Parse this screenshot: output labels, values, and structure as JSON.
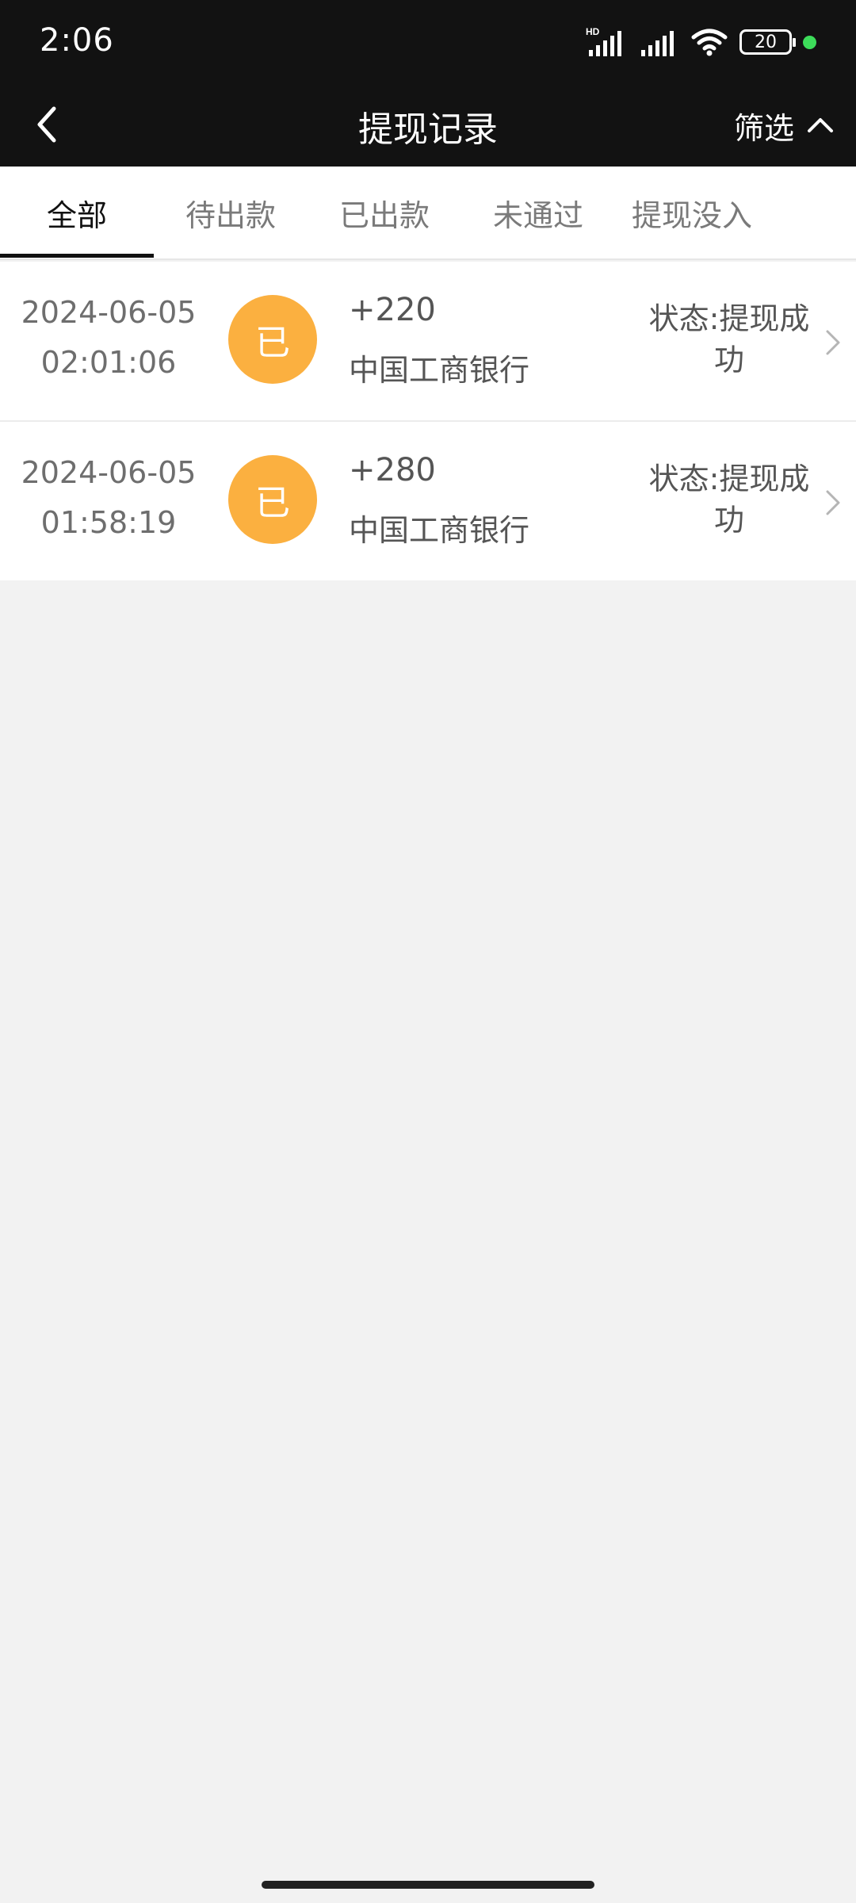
{
  "status_bar": {
    "time": "2:06",
    "battery": "20",
    "network_badge": "HD",
    "icons": [
      "signal-hd-icon",
      "signal-icon",
      "wifi-icon",
      "battery-icon",
      "privacy-dot-icon"
    ]
  },
  "navbar": {
    "title": "提现记录",
    "filter_label": "筛选",
    "back_icon": "chevron-left-icon",
    "filter_icon": "chevron-up-icon"
  },
  "tabs": [
    {
      "label": "全部",
      "active": true
    },
    {
      "label": "待出款",
      "active": false
    },
    {
      "label": "已出款",
      "active": false
    },
    {
      "label": "未通过",
      "active": false
    },
    {
      "label": "提现没入",
      "active": false
    }
  ],
  "records": [
    {
      "date": "2024-06-05",
      "time": "02:01:06",
      "badge": "已",
      "amount": "+220",
      "bank": "中国工商银行",
      "status": "状态:提现成功"
    },
    {
      "date": "2024-06-05",
      "time": "01:58:19",
      "badge": "已",
      "amount": "+280",
      "bank": "中国工商银行",
      "status": "状态:提现成功"
    }
  ],
  "colors": {
    "header_bg": "#121212",
    "badge": "#fbb040",
    "page_bg": "#f2f2f2",
    "active_tab": "#111111",
    "status_dot": "#3ddc5a"
  }
}
